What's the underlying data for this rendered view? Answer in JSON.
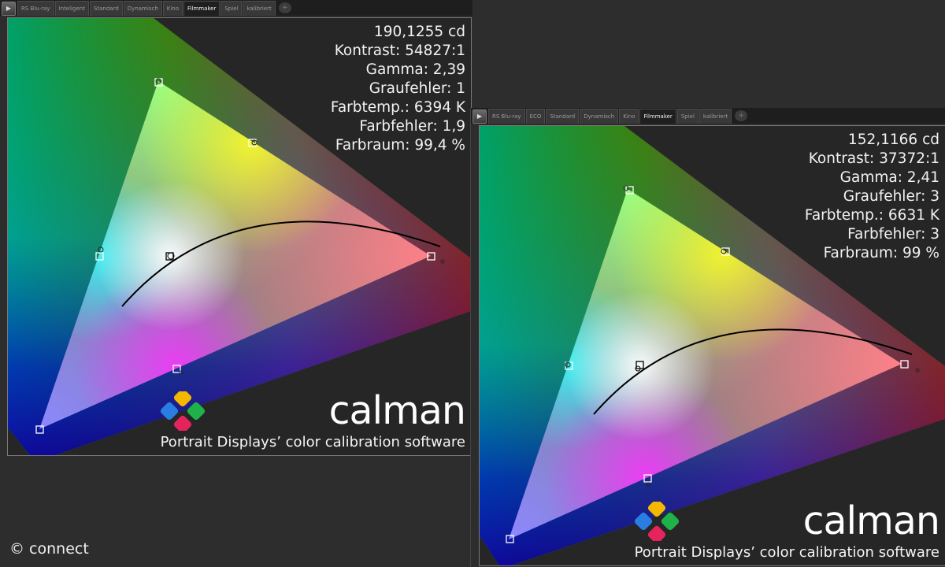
{
  "panels": {
    "left": {
      "tabs": [
        "RS Blu-ray",
        "Inteligent",
        "Standard",
        "Dynamisch",
        "Kino",
        "Filmmaker",
        "Spiel",
        "kalibriert"
      ],
      "active_tab": "Filmmaker",
      "stats": {
        "luminance": "190,1255 cd",
        "kontrast": "Kontrast: 54827:1",
        "gamma": "Gamma: 2,39",
        "graufehler": "Graufehler: 1",
        "farbtemp": "Farbtemp.: 6394 K",
        "farbfehler": "Farbfehler: 1,9",
        "farbraum": "Farbraum: 99,4 %"
      }
    },
    "right": {
      "tabs": [
        "RS Blu-ray",
        "ECO",
        "Standard",
        "Dynamisch",
        "Kino",
        "Filmmaker",
        "Spiel",
        "kalibriert"
      ],
      "active_tab": "Filmmaker",
      "stats": {
        "luminance": "152,1166 cd",
        "kontrast": "Kontrast: 37372:1",
        "gamma": "Gamma: 2,41",
        "graufehler": "Graufehler: 3",
        "farbtemp": "Farbtemp.: 6631 K",
        "farbfehler": "Farbfehler: 3",
        "farbraum": "Farbraum: 99 %"
      }
    }
  },
  "brand": {
    "name": "calman",
    "tagline": "Portrait Displays’ color calibration software",
    "logo_colors": [
      "#f5b800",
      "#1fb24a",
      "#2a7de1",
      "#e5245e"
    ]
  },
  "icons": {
    "play": "play-icon",
    "add_tab": "add-tab-icon"
  },
  "credit": "© connect"
}
